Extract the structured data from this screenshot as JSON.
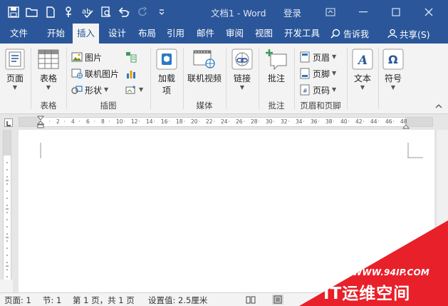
{
  "window": {
    "title": "文档1  -  Word",
    "login": "登录"
  },
  "tabs": [
    "文件",
    "开始",
    "插入",
    "设计",
    "布局",
    "引用",
    "邮件",
    "审阅",
    "视图",
    "开发工具"
  ],
  "tell_me": "告诉我",
  "share": "共享(S)",
  "ribbon": {
    "pages": {
      "button": "页面",
      "group": ""
    },
    "tables": {
      "button": "表格",
      "group": "表格"
    },
    "illustrations": {
      "picture": "图片",
      "online_picture": "联机图片",
      "shapes": "形状",
      "group": "插图"
    },
    "addins": {
      "button_line1": "加载",
      "button_line2": "项"
    },
    "media": {
      "button": "联机视频",
      "group": "媒体"
    },
    "links": {
      "button": "链接"
    },
    "comments": {
      "button": "批注",
      "group": "批注"
    },
    "header_footer": {
      "header": "页眉",
      "footer": "页脚",
      "page_number": "页码",
      "group": "页眉和页脚"
    },
    "text": {
      "button": "文本"
    },
    "symbols": {
      "button": "符号"
    }
  },
  "ruler_ticks": [
    "2",
    "4",
    "6",
    "8",
    "10",
    "12",
    "14",
    "16",
    "18",
    "20",
    "22",
    "24",
    "26",
    "28",
    "30",
    "32",
    "34",
    "36",
    "38",
    "40",
    "42",
    "44",
    "46",
    "48"
  ],
  "status": {
    "page": "页面: 1",
    "section": "节: 1",
    "page_of": "第 1 页，共 1 页",
    "setting": "设置值: 2.5厘米"
  },
  "watermark": {
    "url": "WWW.94IP.COM",
    "text": "IT运维空间"
  },
  "colors": {
    "title_bar": "#2b579a",
    "watermark": "#e8202a"
  }
}
